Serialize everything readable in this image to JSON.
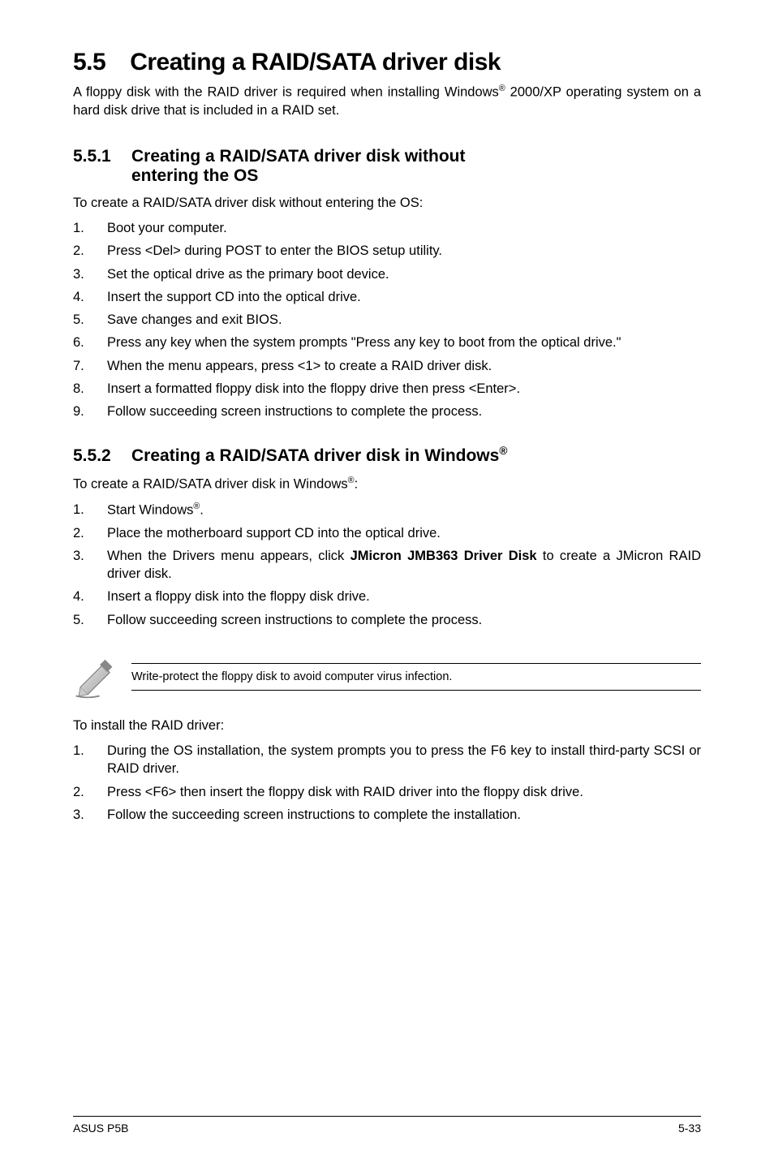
{
  "h1_num": "5.5",
  "h1_title": "Creating a RAID/SATA driver disk",
  "intro_pre": "A floppy disk with the RAID driver is required when installing Windows",
  "intro_sup": "®",
  "intro_post": " 2000/XP operating system on a hard disk drive that is included in a RAID set.",
  "s551_num": "5.5.1",
  "s551_title_line1": "Creating a RAID/SATA driver disk without",
  "s551_title_line2": "entering the OS",
  "s551_lead": "To create a RAID/SATA driver disk without entering the OS:",
  "s551_steps": [
    "Boot your computer.",
    "Press <Del> during POST to enter the BIOS setup utility.",
    "Set the optical drive as the primary boot device.",
    "Insert the support CD into the optical drive.",
    "Save changes and exit BIOS.",
    "Press any key when the system prompts \"Press any key to boot from the optical drive.\"",
    "When the menu appears, press <1> to create a RAID driver disk.",
    "Insert a formatted floppy disk into the floppy drive then press <Enter>.",
    "Follow succeeding screen instructions to complete the process."
  ],
  "s552_num": "5.5.2",
  "s552_title": "Creating a RAID/SATA driver disk in Windows",
  "s552_sup": "®",
  "s552_lead_pre": "To create a RAID/SATA driver disk in Windows",
  "s552_lead_sup": "®",
  "s552_lead_post": ":",
  "s552_step1_pre": "Start Windows",
  "s552_step1_sup": "®",
  "s552_step1_post": ".",
  "s552_step2": "Place the motherboard support CD into the optical drive.",
  "s552_step3_pre": "When the Drivers menu appears, click ",
  "s552_step3_bold": "JMicron JMB363 Driver Disk",
  "s552_step3_post": " to create a JMicron RAID driver disk.",
  "s552_step4": "Insert a floppy disk into the floppy disk drive.",
  "s552_step5": "Follow succeeding screen instructions to complete the process.",
  "note_text": "Write-protect the floppy disk to avoid computer virus infection.",
  "install_lead": "To install the RAID driver:",
  "install_steps": [
    "During the OS installation, the system prompts you to press the F6 key to install third-party SCSI or RAID driver.",
    "Press <F6> then insert the floppy disk with RAID driver into the floppy disk drive.",
    "Follow the succeeding screen instructions to complete the installation."
  ],
  "footer_left": "ASUS P5B",
  "footer_right": "5-33"
}
